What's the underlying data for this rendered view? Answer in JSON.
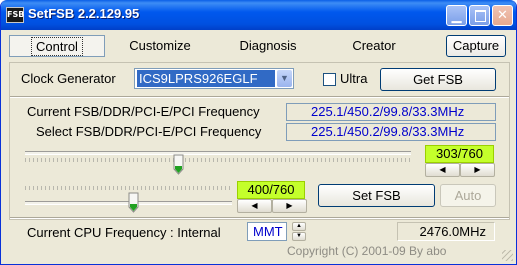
{
  "window": {
    "title": "SetFSB 2.2.129.95",
    "icon_text": "FSB"
  },
  "tabs": [
    {
      "label": "Control",
      "active": true
    },
    {
      "label": "Customize",
      "active": false
    },
    {
      "label": "Diagnosis",
      "active": false
    },
    {
      "label": "Creator",
      "active": false
    }
  ],
  "capture_label": "Capture",
  "clock": {
    "label": "Clock Generator",
    "selected": "ICS9LPRS926EGLF",
    "ultra_label": "Ultra",
    "ultra_checked": false,
    "get_fsb_label": "Get FSB"
  },
  "frequency": {
    "current_label": "Current FSB/DDR/PCI-E/PCI Frequency",
    "current_value": "225.1/450.2/99.8/33.3MHz",
    "select_label": "Select FSB/DDR/PCI-E/PCI Frequency",
    "select_value": "225.1/450.2/99.8/33.3MHz"
  },
  "slider1": {
    "value": "303/760",
    "level": 0.3987
  },
  "slider2": {
    "value": "400/760",
    "level": 0.5263
  },
  "set_fsb_label": "Set FSB",
  "auto_label": "Auto",
  "cpu": {
    "label": "Current CPU Frequency : Internal",
    "mode": "MMT",
    "value": "2476.0MHz"
  },
  "copyright": "Copyright (C) 2001-09 By abo",
  "colors": {
    "titlebar": "#0054e3",
    "value_box": "#c4ff2b",
    "value_text": "#0000cc",
    "dropdown_selection": "#316ac5"
  },
  "icons": {
    "minimize": "minimize-icon",
    "maximize": "maximize-icon",
    "close": "close-icon",
    "dropdown": "chevron-down-icon",
    "spin_left": "arrow-left-icon",
    "spin_right": "arrow-right-icon"
  }
}
